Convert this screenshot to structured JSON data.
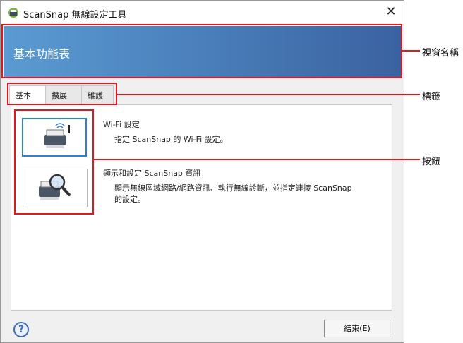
{
  "window": {
    "title": "ScanSnap 無線設定工具",
    "close_symbol": "✕"
  },
  "banner": {
    "title": "基本功能表"
  },
  "tabs": [
    {
      "label": "基本",
      "active": true
    },
    {
      "label": "擴展",
      "active": false
    },
    {
      "label": "維護",
      "active": false
    }
  ],
  "items": [
    {
      "title": "Wi-Fi 設定",
      "description": "指定 ScanSnap 的 Wi-Fi 設定。",
      "icon": "scanner-wifi-icon"
    },
    {
      "title": "顯示和設定 ScanSnap 資訊",
      "description_line1": "顯示無線區域網路/網路資訊、執行無線診斷，並指定連接 ScanSnap",
      "description_line2": "的設定。",
      "icon": "scanner-magnifier-icon"
    }
  ],
  "footer": {
    "help_symbol": "?",
    "end_label": "結束(E)"
  },
  "callouts": {
    "window_name": "視窗名稱",
    "tabs": "標籤",
    "buttons": "按鈕"
  },
  "colors": {
    "highlight": "#e0191e",
    "banner_start": "#5b9bd2",
    "banner_end": "#3a62a0",
    "selected_border": "#2e7fd6"
  }
}
